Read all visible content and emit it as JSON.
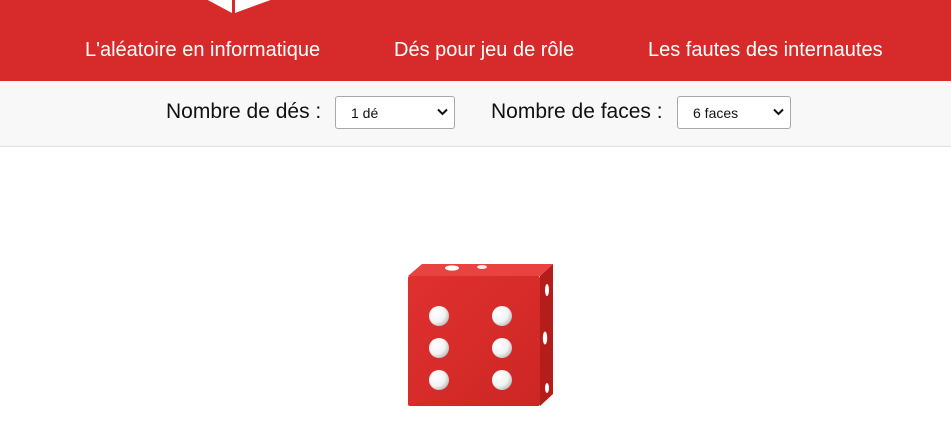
{
  "brand": {
    "accent": "#d72b2b",
    "logo_icon": "dice-logo-icon"
  },
  "nav": {
    "items": [
      {
        "label": "L'aléatoire en informatique"
      },
      {
        "label": "Dés pour jeu de rôle"
      },
      {
        "label": "Les fautes des internautes"
      }
    ]
  },
  "controls": {
    "dice_count": {
      "label": "Nombre de dés :",
      "selected": "1 dé",
      "icon": "chevron-down-icon"
    },
    "faces": {
      "label": "Nombre de faces :",
      "selected": "6 faces",
      "icon": "chevron-down-icon"
    }
  },
  "dice": [
    {
      "value": 6,
      "faces": 6,
      "color": "#d72b2b",
      "icon": "die-six-icon"
    }
  ]
}
